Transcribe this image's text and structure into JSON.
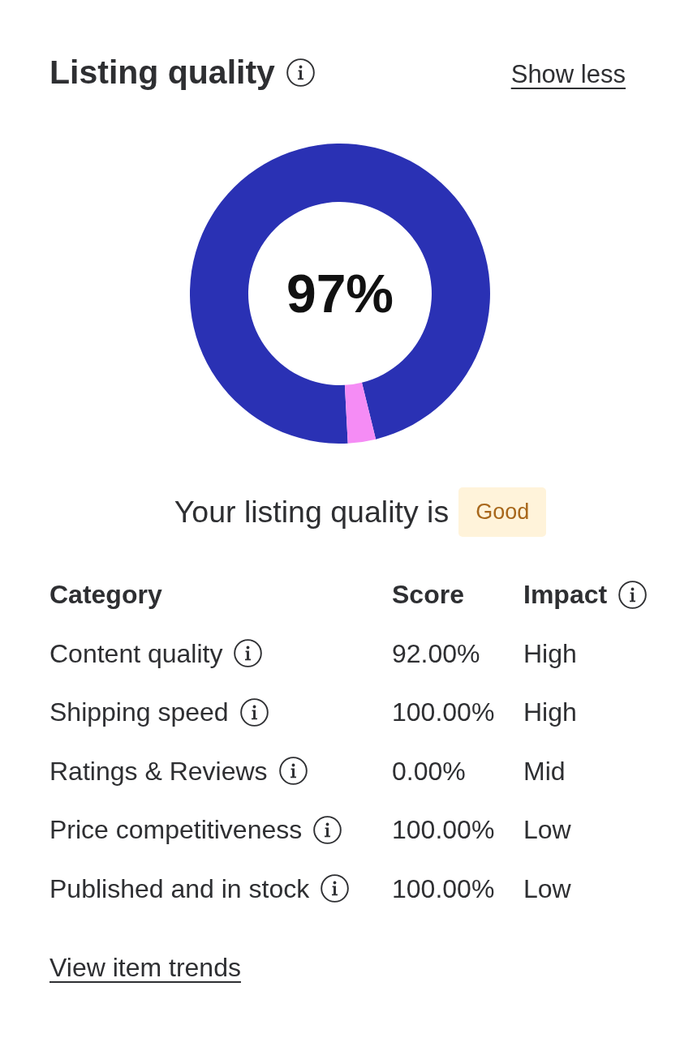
{
  "header": {
    "title": "Listing quality",
    "info": true,
    "toggle_link": "Show less"
  },
  "score_ring": {
    "level": 0.97,
    "label": "97%"
  },
  "summary": {
    "text": "Your listing quality is",
    "badge": "Good"
  },
  "table": {
    "columns": [
      {
        "label": "Category",
        "info": false
      },
      {
        "label": "Score",
        "info": false
      },
      {
        "label": "Impact",
        "info": true
      }
    ],
    "rows": [
      {
        "category": "Content quality",
        "info": true,
        "score": "92.00%",
        "impact": "High"
      },
      {
        "category": "Shipping speed",
        "info": true,
        "score": "100.00%",
        "impact": "High"
      },
      {
        "category": "Ratings & Reviews",
        "info": true,
        "score": "0.00%",
        "impact": "Mid"
      },
      {
        "category": "Price competitiveness",
        "info": true,
        "score": "100.00%",
        "impact": "Low"
      },
      {
        "category": "Published and in stock",
        "info": true,
        "score": "100.00%",
        "impact": "Low"
      }
    ]
  },
  "footer_link": "View item trends"
}
